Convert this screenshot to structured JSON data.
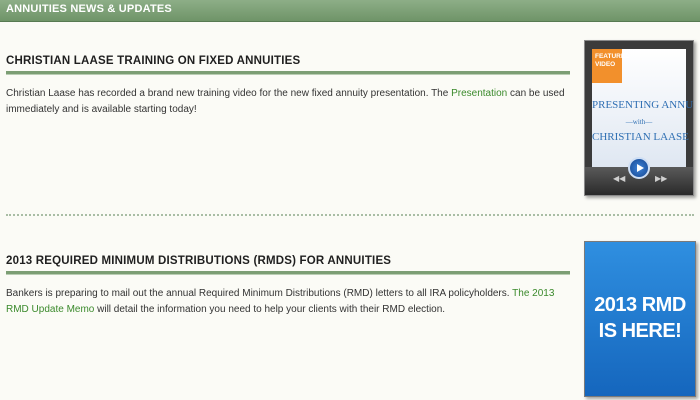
{
  "header": {
    "title": "ANNUITIES NEWS & UPDATES"
  },
  "articles": [
    {
      "title": "CHRISTIAN LAASE TRAINING ON FIXED ANNUITIES",
      "body_before": "Christian Laase has recorded a brand new training video for the new fixed annuity presentation. The ",
      "link": "Presentation",
      "body_after": " can be used immediately and is available starting today!"
    },
    {
      "title": "2013 REQUIRED MINIMUM DISTRIBUTIONS (RMDS) FOR ANNUITIES",
      "body_before": "Bankers is preparing to mail out the annual Required Minimum Distributions (RMD) letters to all IRA policyholders. ",
      "link": "The 2013 RMD Update Memo",
      "body_after": " will detail the information you need to help your clients with their RMD election."
    }
  ],
  "video_thumb": {
    "tag_line1": "FEATURED",
    "tag_line2": "VIDEO",
    "line1": "PRESENTING ANNUITIES",
    "with": "—with—",
    "line2": "CHRISTIAN LAASE",
    "icon": "play-icon"
  },
  "rmd_promo": {
    "line1": "2013 RMD",
    "line2": "IS HERE!"
  },
  "colors": {
    "header": "#7a9f73",
    "rule": "#7c9e74",
    "link": "#3b8a2c",
    "promo_blue": "#1e7bd4",
    "featured_orange": "#f2902c"
  }
}
